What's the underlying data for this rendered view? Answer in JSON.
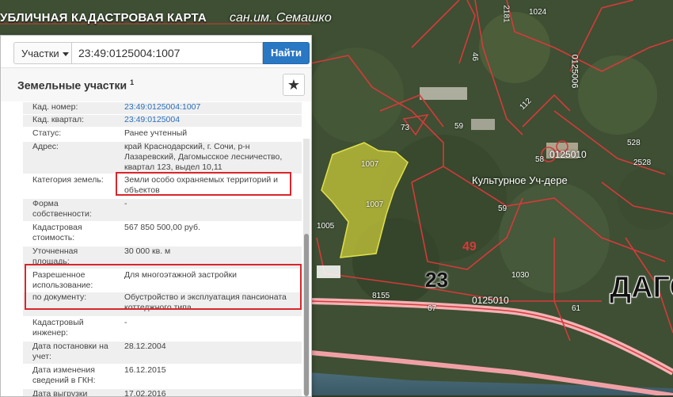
{
  "app": {
    "title": "УБЛИЧНАЯ КАДАСТРОВАЯ КАРТА"
  },
  "search": {
    "scope_label": "Участки",
    "query": "23:49:0125004:1007",
    "submit_label": "Найти"
  },
  "panel": {
    "title": "Земельные участки",
    "count": "1",
    "fields": [
      {
        "label": "Кад. номер:",
        "value": "23:49:0125004:1007",
        "link": true
      },
      {
        "label": "Кад. квартал:",
        "value": "23:49:0125004",
        "link": true
      },
      {
        "label": "Статус:",
        "value": "Ранее учтенный"
      },
      {
        "label": "Адрес:",
        "value": "край Краснодарский, г. Сочи, р-н Лазаревский, Дагомысское лесничество, квартал 123, выдел 10,11"
      },
      {
        "label": "Категория земель:",
        "value": "Земли особо охраняемых территорий и объектов"
      },
      {
        "label": "Форма собственности:",
        "value": "-"
      },
      {
        "label": "Кадастровая стоимость:",
        "value": "567 850 500,00 руб."
      },
      {
        "label": "Уточненная площадь:",
        "value": "30 000 кв. м"
      },
      {
        "label": "Разрешенное использование:",
        "value": "Для многоэтажной застройки"
      },
      {
        "label": "по документу:",
        "value": "Обустройство и эксплуатация пансионата коттеджного типа"
      },
      {
        "label": "Кадастровый инженер:",
        "value": "-"
      },
      {
        "label": "Дата постановки на учет:",
        "value": "28.12.2004"
      },
      {
        "label": "Дата изменения сведений в ГКН:",
        "value": "16.12.2015"
      },
      {
        "label": "Дата выгрузки",
        "value": "17.02.2016"
      }
    ]
  },
  "map": {
    "labels": [
      {
        "text": "сан.им. Семашко",
        "name": "map-label-sanatorium"
      },
      {
        "text": "Культурное Уч-дере",
        "name": "map-label-kulturnoe"
      },
      {
        "text": "ДАГО",
        "name": "map-label-dago"
      },
      {
        "text": "23",
        "name": "map-label-zone-23"
      },
      {
        "text": "49",
        "name": "map-label-zone-49"
      },
      {
        "text": "0125010",
        "name": "map-label-quarter-1"
      },
      {
        "text": "0125010",
        "name": "map-label-quarter-2"
      },
      {
        "text": "0125006",
        "name": "map-label-quarter-3"
      },
      {
        "text": "1007",
        "name": "parcel-label-top"
      },
      {
        "text": "1007",
        "name": "parcel-label-bottom"
      },
      {
        "text": "1005",
        "name": "parcel-label-1005"
      },
      {
        "text": "1024",
        "name": "parcel-label-1024"
      },
      {
        "text": "2181",
        "name": "parcel-label-2181"
      },
      {
        "text": "73",
        "name": "parcel-label-73"
      },
      {
        "text": "59",
        "name": "parcel-label-59a"
      },
      {
        "text": "59",
        "name": "parcel-label-59b"
      },
      {
        "text": "58",
        "name": "parcel-label-58"
      },
      {
        "text": "528",
        "name": "parcel-label-528"
      },
      {
        "text": "2528",
        "name": "parcel-label-2528"
      },
      {
        "text": "1030",
        "name": "parcel-label-1030"
      },
      {
        "text": "8155",
        "name": "parcel-label-8155"
      },
      {
        "text": "67",
        "name": "parcel-label-67"
      },
      {
        "text": "61",
        "name": "parcel-label-61"
      },
      {
        "text": "112",
        "name": "parcel-label-112"
      },
      {
        "text": "46",
        "name": "parcel-label-46"
      }
    ]
  },
  "colors": {
    "accent": "#2a78c4",
    "highlight": "#d9262b",
    "parcel": "#c8c83a",
    "boundary": "#d63a3a"
  }
}
